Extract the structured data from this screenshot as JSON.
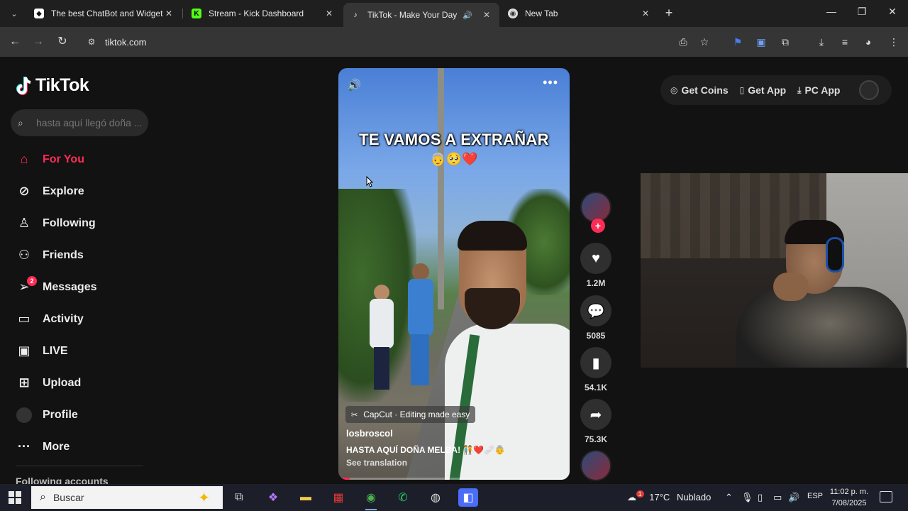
{
  "browser": {
    "tabs": [
      {
        "title": "The best ChatBot and Widgets",
        "active": false
      },
      {
        "title": "Stream - Kick Dashboard",
        "active": false
      },
      {
        "title": "TikTok - Make Your Day",
        "active": true
      },
      {
        "title": "New Tab",
        "active": false
      }
    ],
    "url": "tiktok.com"
  },
  "tiktok": {
    "logo": "TikTok",
    "search_placeholder": "hasta aquí llegó doña ...",
    "nav": [
      {
        "label": "For You",
        "icon": "home-icon"
      },
      {
        "label": "Explore",
        "icon": "compass-icon"
      },
      {
        "label": "Following",
        "icon": "user-follow-icon"
      },
      {
        "label": "Friends",
        "icon": "friends-icon"
      },
      {
        "label": "Messages",
        "icon": "send-icon",
        "badge": "2"
      },
      {
        "label": "Activity",
        "icon": "activity-icon"
      },
      {
        "label": "LIVE",
        "icon": "live-icon"
      },
      {
        "label": "Upload",
        "icon": "plus-square-icon"
      },
      {
        "label": "Profile",
        "icon": "avatar"
      },
      {
        "label": "More",
        "icon": "more-dots-icon"
      }
    ],
    "following_accounts": "Following accounts",
    "top_right": {
      "get_coins": "Get Coins",
      "get_app": "Get App",
      "pc_app": "PC App"
    },
    "video": {
      "overlay_text": "TE VAMOS A EXTRAÑAR",
      "overlay_emoji": "👵🥺❤️",
      "capcut": "CapCut · Editing made easy",
      "username": "losbroscol",
      "description": "HASTA AQUÍ DOÑA MELBA! 🧑‍🤝‍🧑❤️🩹👵",
      "see_translation": "See translation",
      "progress": 0.05
    },
    "actions": {
      "likes": "1.2M",
      "comments": "5085",
      "saves": "54.1K",
      "shares": "75.3K"
    }
  },
  "taskbar": {
    "search": "Buscar",
    "weather_temp": "17°C",
    "weather_text": "Nublado",
    "weather_badge": "1",
    "language": "ESP",
    "time": "11:02 p. m.",
    "date": "7/08/2025"
  },
  "colors": {
    "accent": "#fe2c55",
    "page_bg": "#121212"
  }
}
